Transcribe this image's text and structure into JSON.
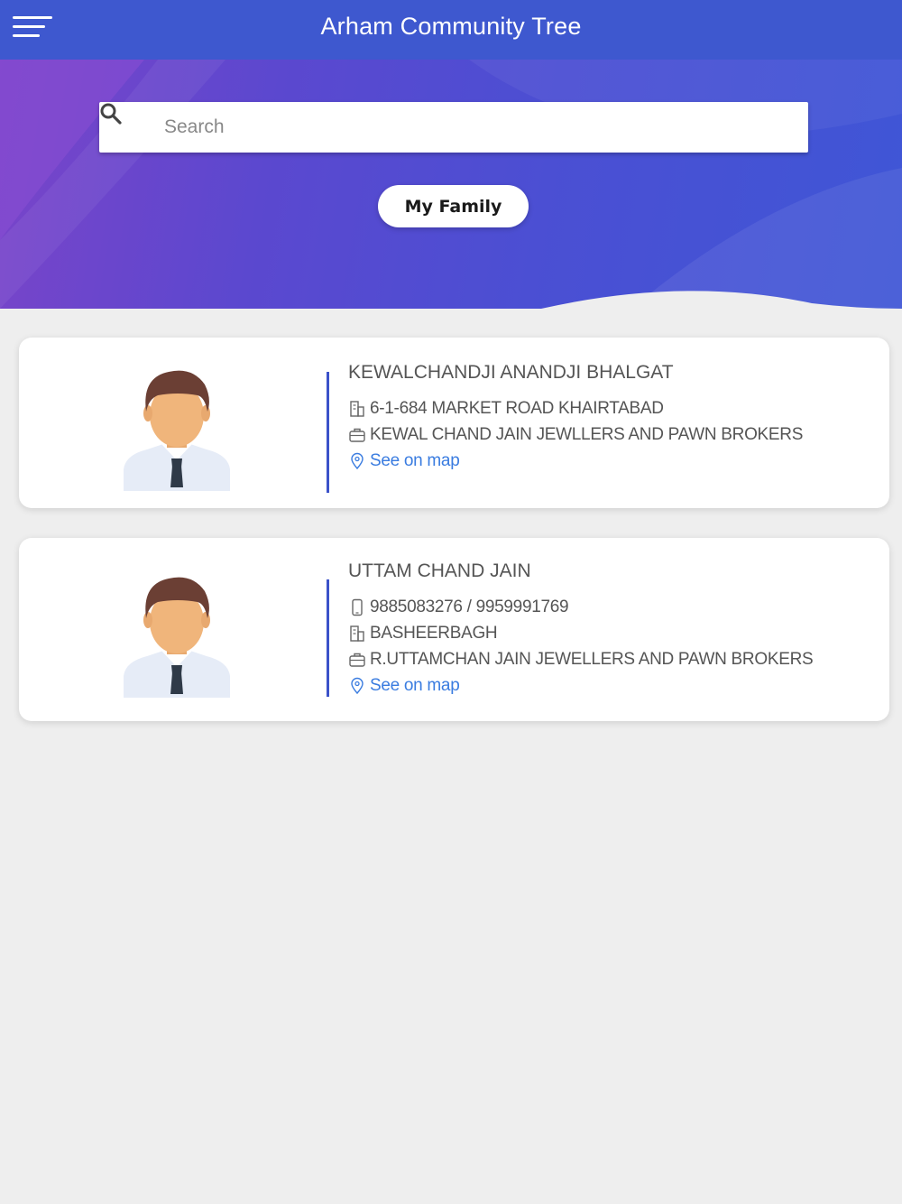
{
  "header": {
    "title": "Arham Community Tree",
    "menu_icon": "hamburger-menu-icon",
    "color": "#3e58cf"
  },
  "search": {
    "placeholder": "Search",
    "value": "",
    "icon": "search-icon"
  },
  "hero": {
    "family_button_label": "My Family",
    "gradient": [
      "#7a44c9",
      "#4b4fd3",
      "#3f56d6"
    ]
  },
  "members": [
    {
      "name": "KEWALCHANDJI ANANDJI BHALGAT",
      "address": "6-1-684 MARKET ROAD KHAIRTABAD",
      "business": "KEWAL CHAND JAIN JEWLLERS AND PAWN BROKERS",
      "map_link": "See on map"
    },
    {
      "name": "UTTAM CHAND JAIN",
      "phone": "9885083276 / 9959991769",
      "address": "BASHEERBAGH",
      "business": "R.UTTAMCHAN JAIN JEWELLERS AND PAWN BROKERS",
      "map_link": "See on map"
    }
  ],
  "colors": {
    "accent_divider": "#3b52c9",
    "link": "#3a7ce0",
    "page_background": "#eeeeee"
  }
}
